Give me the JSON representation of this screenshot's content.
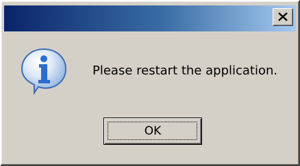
{
  "dialog": {
    "title": "",
    "message": "Please restart the application.",
    "ok_label": "OK",
    "icon": "info-icon"
  },
  "colors": {
    "titlebar_start": "#0a246a",
    "titlebar_end": "#a6caf0",
    "face": "#d4d0c8",
    "icon_blue": "#2a6dcf"
  }
}
